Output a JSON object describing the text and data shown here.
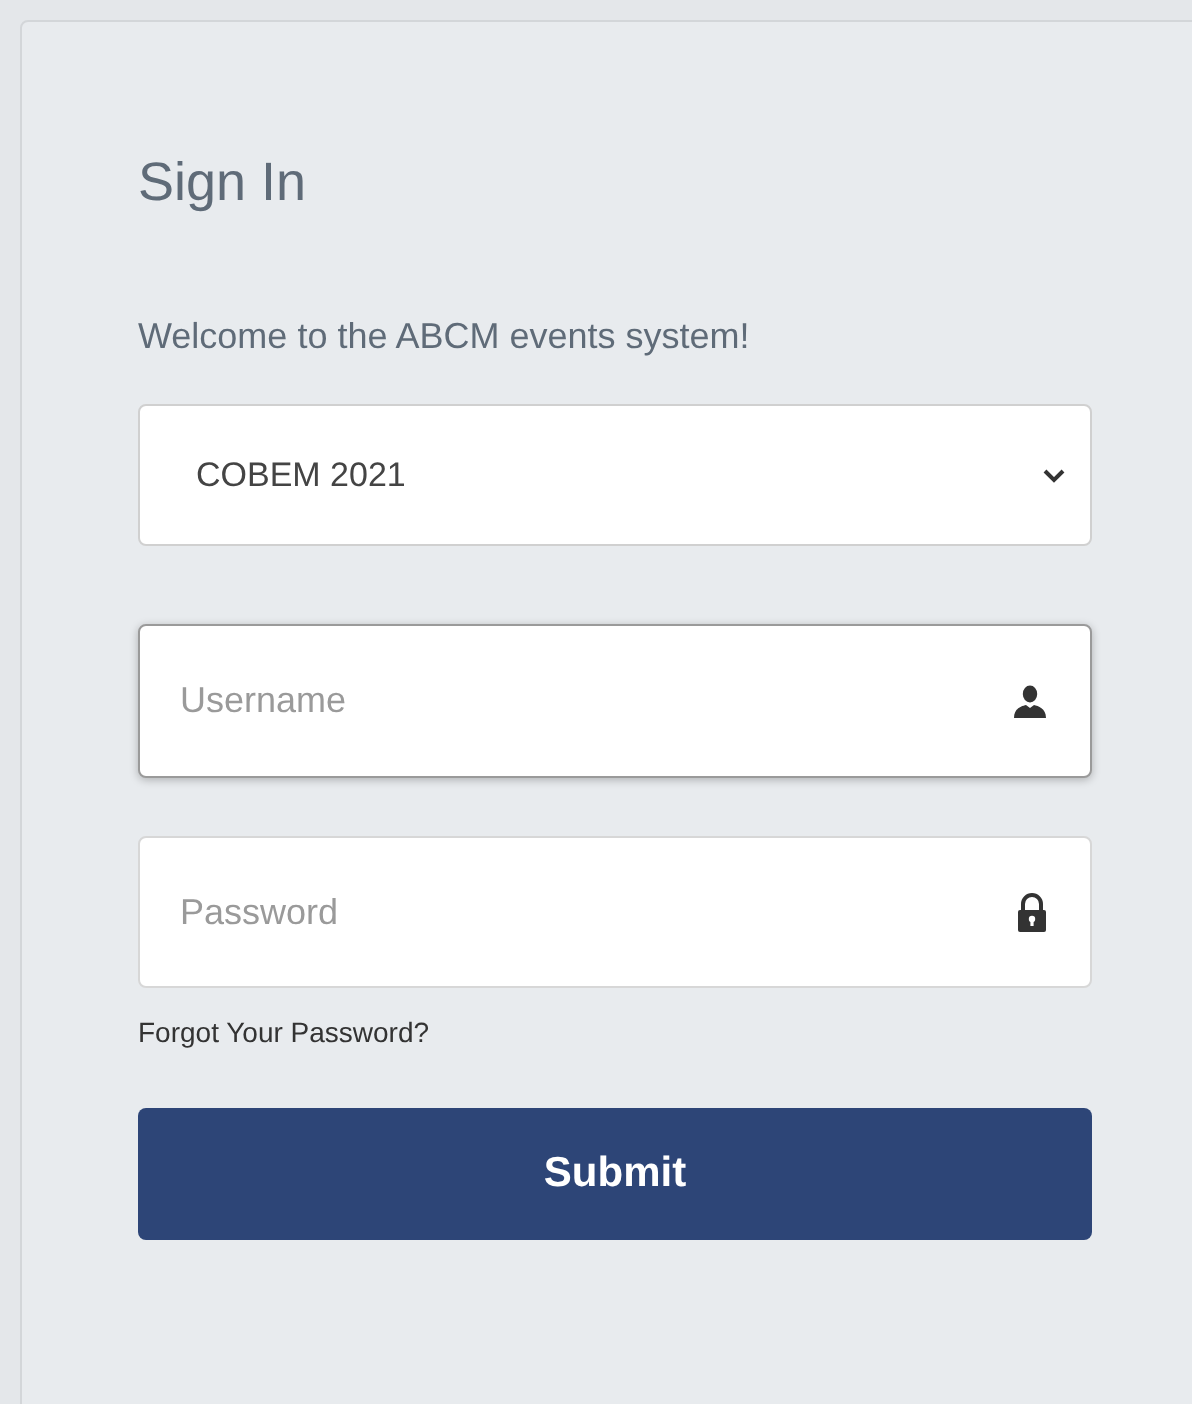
{
  "title": "Sign In",
  "welcome": "Welcome to the ABCM events system!",
  "event_select": {
    "value": "COBEM 2021"
  },
  "fields": [
    {
      "kind": "user",
      "placeholder": "Username",
      "focused": true
    },
    {
      "kind": "lock",
      "placeholder": "Password",
      "focused": false
    }
  ],
  "forgot_link": "Forgot Your Password?",
  "submit_button": "Submit"
}
